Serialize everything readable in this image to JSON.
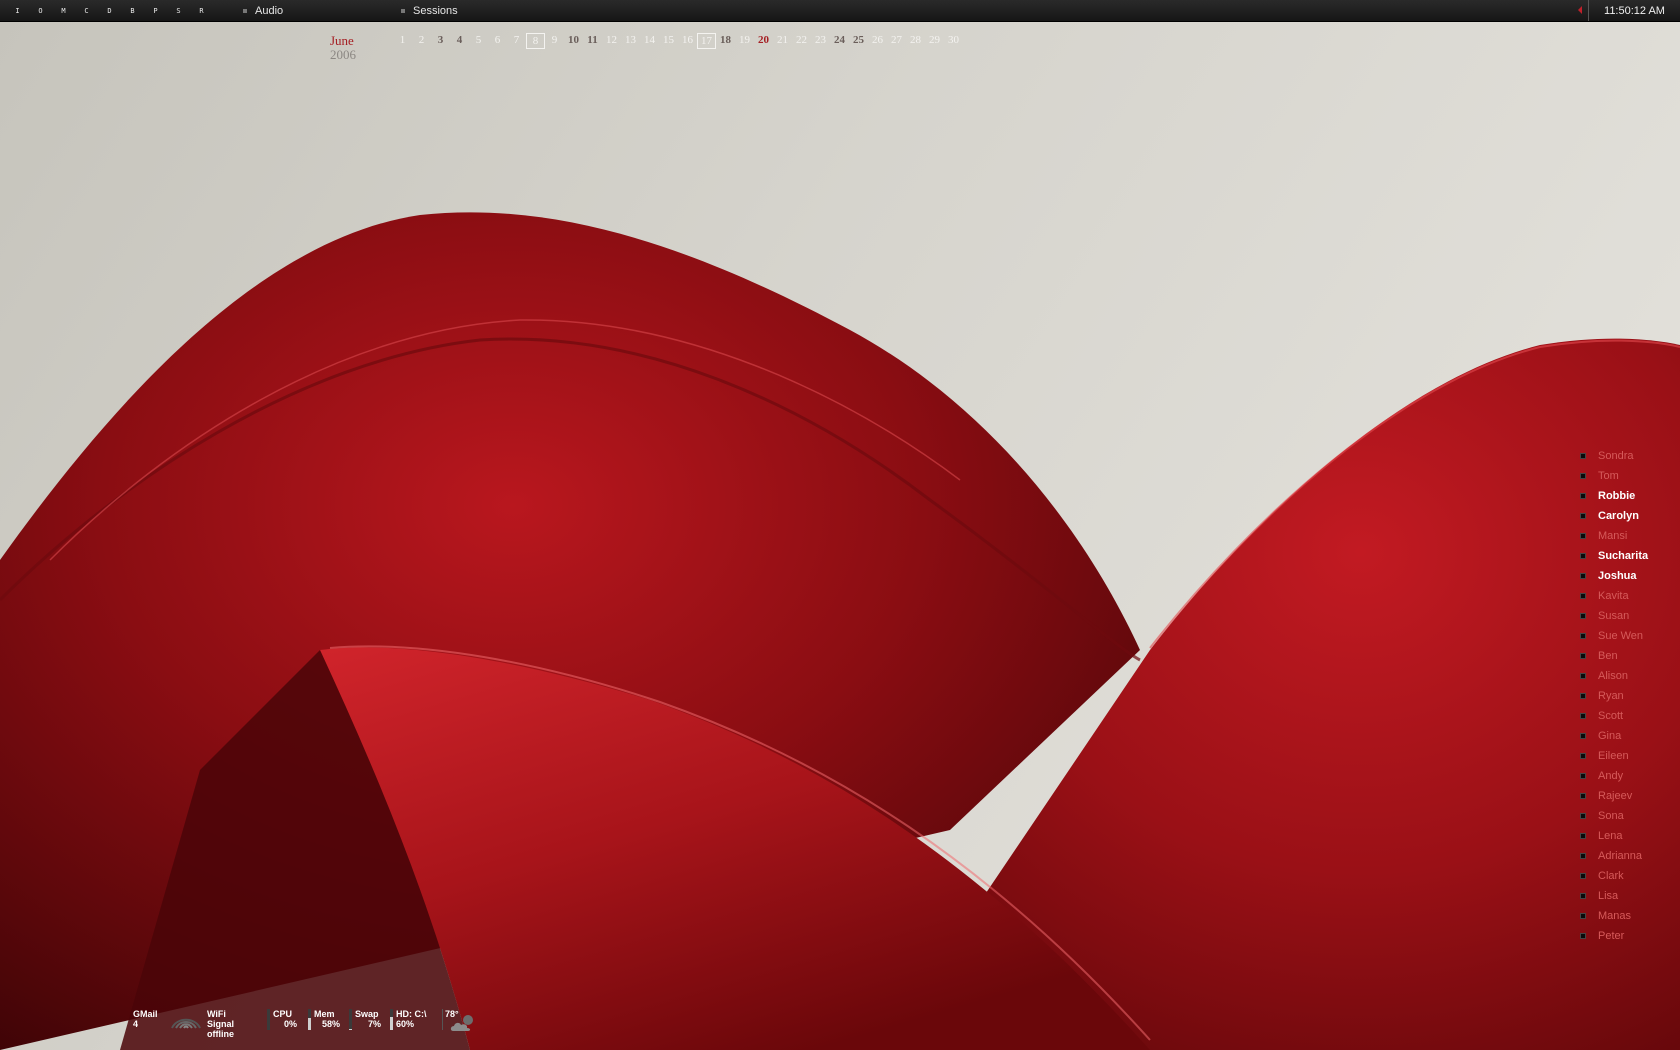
{
  "topbar": {
    "launcher": [
      "I",
      "O",
      "M",
      "C",
      "D",
      "B",
      "P",
      "S",
      "R"
    ],
    "menu": [
      {
        "label": "Audio"
      },
      {
        "label": "Sessions"
      }
    ],
    "clock": "11:50:12 AM",
    "tray_arrow_color": "#c0202a"
  },
  "calendar": {
    "month": "June",
    "year": "2006",
    "days": [
      {
        "d": "1"
      },
      {
        "d": "2"
      },
      {
        "d": "3",
        "style": "bold"
      },
      {
        "d": "4",
        "style": "bold"
      },
      {
        "d": "5"
      },
      {
        "d": "6"
      },
      {
        "d": "7"
      },
      {
        "d": "8",
        "style": "boxed"
      },
      {
        "d": "9"
      },
      {
        "d": "10",
        "style": "bold"
      },
      {
        "d": "11",
        "style": "bold"
      },
      {
        "d": "12"
      },
      {
        "d": "13"
      },
      {
        "d": "14"
      },
      {
        "d": "15"
      },
      {
        "d": "16"
      },
      {
        "d": "17",
        "style": "boxed"
      },
      {
        "d": "18",
        "style": "bold"
      },
      {
        "d": "19"
      },
      {
        "d": "20",
        "style": "red"
      },
      {
        "d": "21"
      },
      {
        "d": "22"
      },
      {
        "d": "23"
      },
      {
        "d": "24",
        "style": "bold"
      },
      {
        "d": "25",
        "style": "bold"
      },
      {
        "d": "26"
      },
      {
        "d": "27"
      },
      {
        "d": "28"
      },
      {
        "d": "29"
      },
      {
        "d": "30"
      }
    ],
    "accent_color": "#a51e23"
  },
  "contacts": [
    {
      "name": "Sondra",
      "active": false
    },
    {
      "name": "Tom",
      "active": false
    },
    {
      "name": "Robbie",
      "active": true
    },
    {
      "name": "Carolyn",
      "active": true
    },
    {
      "name": "Mansi",
      "active": false
    },
    {
      "name": "Sucharita",
      "active": true
    },
    {
      "name": "Joshua",
      "active": true
    },
    {
      "name": "Kavita",
      "active": false
    },
    {
      "name": "Susan",
      "active": false
    },
    {
      "name": "Sue Wen",
      "active": false
    },
    {
      "name": "Ben",
      "active": false
    },
    {
      "name": "Alison",
      "active": false
    },
    {
      "name": "Ryan",
      "active": false
    },
    {
      "name": "Scott",
      "active": false
    },
    {
      "name": "Gina",
      "active": false
    },
    {
      "name": "Eileen",
      "active": false
    },
    {
      "name": "Andy",
      "active": false
    },
    {
      "name": "Rajeev",
      "active": false
    },
    {
      "name": "Sona",
      "active": false
    },
    {
      "name": "Lena",
      "active": false
    },
    {
      "name": "Adrianna",
      "active": false
    },
    {
      "name": "Clark",
      "active": false
    },
    {
      "name": "Lisa",
      "active": false
    },
    {
      "name": "Manas",
      "active": false
    },
    {
      "name": "Peter",
      "active": false
    }
  ],
  "status": {
    "gmail": {
      "label": "GMail",
      "value": "4"
    },
    "wifi": {
      "label": "WiFi Signal",
      "value": "offline",
      "icon": "wifi-icon"
    },
    "cpu": {
      "label": "CPU",
      "value": "0%",
      "level": 0
    },
    "mem": {
      "label": "Mem",
      "value": "58%",
      "level": 58
    },
    "swap": {
      "label": "Swap",
      "value": "7%",
      "level": 7
    },
    "hd": {
      "label": "HD: C:\\",
      "value": "60%",
      "level": 60
    },
    "weather": {
      "temp": "78°",
      "icon": "partly-cloudy-icon"
    }
  }
}
